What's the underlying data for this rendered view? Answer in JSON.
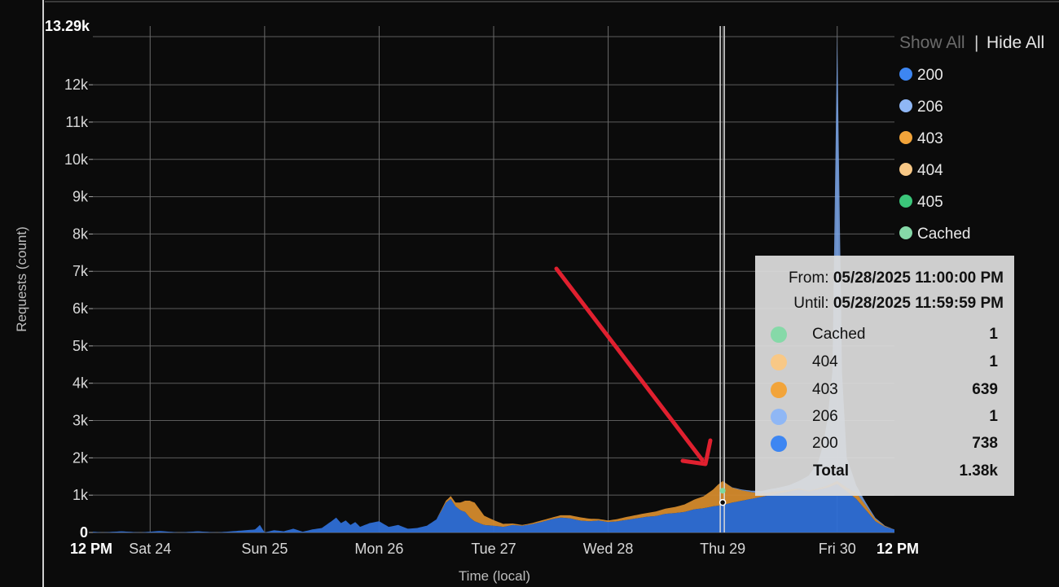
{
  "chart_data": {
    "type": "area",
    "stacked": true,
    "ylabel": "Requests (count)",
    "xlabel": "Time (local)",
    "y_max_label": "13.29k",
    "ylim": [
      0,
      13290
    ],
    "y_ticks": [
      {
        "value": 0,
        "label": "0"
      },
      {
        "value": 1000,
        "label": "1k"
      },
      {
        "value": 2000,
        "label": "2k"
      },
      {
        "value": 3000,
        "label": "3k"
      },
      {
        "value": 4000,
        "label": "4k"
      },
      {
        "value": 5000,
        "label": "5k"
      },
      {
        "value": 6000,
        "label": "6k"
      },
      {
        "value": 7000,
        "label": "7k"
      },
      {
        "value": 8000,
        "label": "8k"
      },
      {
        "value": 9000,
        "label": "9k"
      },
      {
        "value": 10000,
        "label": "10k"
      },
      {
        "value": 11000,
        "label": "11k"
      },
      {
        "value": 12000,
        "label": "12k"
      }
    ],
    "x_range_hours": [
      0,
      144
    ],
    "x_ticks": [
      {
        "hour": 0,
        "label": "12 PM",
        "bold": true,
        "grid": false
      },
      {
        "hour": 12,
        "label": "Sat 24",
        "bold": false,
        "grid": true
      },
      {
        "hour": 36,
        "label": "Sun 25",
        "bold": false,
        "grid": true
      },
      {
        "hour": 60,
        "label": "Mon 26",
        "bold": false,
        "grid": true
      },
      {
        "hour": 84,
        "label": "Tue 27",
        "bold": false,
        "grid": true
      },
      {
        "hour": 108,
        "label": "Wed 28",
        "bold": false,
        "grid": true
      },
      {
        "hour": 132,
        "label": "Thu 29",
        "bold": false,
        "grid": true
      },
      {
        "hour": 156,
        "label": "Fri 30",
        "bold": false,
        "grid": true
      },
      {
        "hour": 168,
        "label": "12 PM",
        "bold": true,
        "grid": false
      }
    ],
    "legend_position": "right",
    "series": [
      {
        "name": "200",
        "color": "#2f6fd6",
        "points": [
          [
            0,
            20
          ],
          [
            2,
            0
          ],
          [
            6,
            30
          ],
          [
            10,
            0
          ],
          [
            14,
            40
          ],
          [
            18,
            0
          ],
          [
            22,
            30
          ],
          [
            26,
            0
          ],
          [
            30,
            40
          ],
          [
            34,
            80
          ],
          [
            35,
            200
          ],
          [
            36,
            0
          ],
          [
            38,
            60
          ],
          [
            40,
            30
          ],
          [
            42,
            100
          ],
          [
            44,
            20
          ],
          [
            46,
            80
          ],
          [
            48,
            120
          ],
          [
            50,
            300
          ],
          [
            51,
            400
          ],
          [
            52,
            250
          ],
          [
            53,
            320
          ],
          [
            54,
            200
          ],
          [
            55,
            280
          ],
          [
            56,
            150
          ],
          [
            58,
            250
          ],
          [
            60,
            300
          ],
          [
            62,
            150
          ],
          [
            64,
            200
          ],
          [
            66,
            100
          ],
          [
            68,
            120
          ],
          [
            70,
            180
          ],
          [
            72,
            350
          ],
          [
            74,
            800
          ],
          [
            75,
            900
          ],
          [
            76,
            700
          ],
          [
            77,
            600
          ],
          [
            78,
            550
          ],
          [
            79,
            400
          ],
          [
            80,
            300
          ],
          [
            82,
            200
          ],
          [
            84,
            180
          ],
          [
            86,
            150
          ],
          [
            88,
            200
          ],
          [
            90,
            180
          ],
          [
            92,
            220
          ],
          [
            94,
            280
          ],
          [
            96,
            350
          ],
          [
            98,
            400
          ],
          [
            100,
            380
          ],
          [
            102,
            320
          ],
          [
            104,
            300
          ],
          [
            106,
            320
          ],
          [
            108,
            280
          ],
          [
            110,
            300
          ],
          [
            112,
            340
          ],
          [
            114,
            380
          ],
          [
            116,
            420
          ],
          [
            118,
            440
          ],
          [
            120,
            500
          ],
          [
            122,
            520
          ],
          [
            124,
            550
          ],
          [
            126,
            620
          ],
          [
            128,
            650
          ],
          [
            130,
            700
          ],
          [
            132,
            738
          ],
          [
            134,
            800
          ],
          [
            136,
            850
          ],
          [
            138,
            900
          ],
          [
            140,
            950
          ],
          [
            142,
            1000
          ],
          [
            144,
            1050
          ],
          [
            146,
            1100
          ],
          [
            148,
            1150
          ],
          [
            150,
            1100
          ],
          [
            152,
            1150
          ],
          [
            154,
            1200
          ],
          [
            156,
            1300
          ],
          [
            158,
            1100
          ],
          [
            160,
            900
          ],
          [
            162,
            600
          ],
          [
            164,
            300
          ],
          [
            166,
            150
          ],
          [
            168,
            80
          ]
        ]
      },
      {
        "name": "206",
        "color": "#6b9be8",
        "points": [
          [
            0,
            0
          ],
          [
            130,
            0
          ],
          [
            132,
            1
          ],
          [
            134,
            10
          ],
          [
            136,
            20
          ],
          [
            138,
            40
          ],
          [
            140,
            60
          ],
          [
            142,
            80
          ],
          [
            144,
            100
          ],
          [
            146,
            130
          ],
          [
            148,
            200
          ],
          [
            150,
            400
          ],
          [
            152,
            700
          ],
          [
            153,
            1100
          ],
          [
            154,
            1800
          ],
          [
            155,
            3000
          ],
          [
            156,
            12000
          ],
          [
            157,
            3000
          ],
          [
            158,
            800
          ],
          [
            160,
            200
          ],
          [
            162,
            80
          ],
          [
            164,
            30
          ],
          [
            166,
            10
          ],
          [
            168,
            0
          ]
        ]
      },
      {
        "name": "403",
        "color": "#d48a2c",
        "points": [
          [
            0,
            0
          ],
          [
            72,
            0
          ],
          [
            76,
            100
          ],
          [
            78,
            300
          ],
          [
            79,
            450
          ],
          [
            80,
            500
          ],
          [
            81,
            380
          ],
          [
            82,
            250
          ],
          [
            84,
            150
          ],
          [
            86,
            80
          ],
          [
            88,
            40
          ],
          [
            90,
            20
          ],
          [
            92,
            30
          ],
          [
            94,
            40
          ],
          [
            96,
            40
          ],
          [
            98,
            60
          ],
          [
            100,
            80
          ],
          [
            102,
            90
          ],
          [
            104,
            70
          ],
          [
            106,
            40
          ],
          [
            108,
            40
          ],
          [
            110,
            60
          ],
          [
            112,
            80
          ],
          [
            114,
            90
          ],
          [
            116,
            100
          ],
          [
            118,
            120
          ],
          [
            120,
            140
          ],
          [
            122,
            160
          ],
          [
            124,
            200
          ],
          [
            126,
            260
          ],
          [
            128,
            320
          ],
          [
            130,
            450
          ],
          [
            131,
            560
          ],
          [
            132,
            639
          ],
          [
            133,
            520
          ],
          [
            134,
            400
          ],
          [
            136,
            280
          ],
          [
            138,
            180
          ],
          [
            140,
            100
          ],
          [
            142,
            80
          ],
          [
            144,
            60
          ],
          [
            146,
            40
          ],
          [
            148,
            30
          ],
          [
            150,
            20
          ],
          [
            152,
            30
          ],
          [
            154,
            60
          ],
          [
            156,
            80
          ],
          [
            158,
            100
          ],
          [
            160,
            160
          ],
          [
            162,
            120
          ],
          [
            164,
            60
          ],
          [
            166,
            20
          ],
          [
            168,
            0
          ]
        ]
      },
      {
        "name": "404",
        "color": "#f5c37a",
        "points": [
          [
            0,
            0
          ],
          [
            131,
            0
          ],
          [
            132,
            1
          ],
          [
            133,
            0
          ],
          [
            168,
            0
          ]
        ]
      },
      {
        "name": "405",
        "color": "#3fbf71",
        "points": [
          [
            0,
            0
          ],
          [
            168,
            0
          ]
        ]
      },
      {
        "name": "Cached",
        "color": "#7ddba0",
        "points": [
          [
            0,
            0
          ],
          [
            131,
            0
          ],
          [
            132,
            1
          ],
          [
            133,
            0
          ],
          [
            168,
            0
          ]
        ]
      }
    ]
  },
  "legend": {
    "show_all": "Show All",
    "separator": "|",
    "hide_all": "Hide All",
    "items": [
      {
        "label": "200",
        "color": "#3d86f2"
      },
      {
        "label": "206",
        "color": "#8fb7f5"
      },
      {
        "label": "403",
        "color": "#f2a43a"
      },
      {
        "label": "404",
        "color": "#f8c886"
      },
      {
        "label": "405",
        "color": "#3bc67a"
      },
      {
        "label": "Cached",
        "color": "#86d9a8"
      }
    ]
  },
  "tooltip": {
    "from_label": "From:",
    "from_value": "05/28/2025 11:00:00 PM",
    "until_label": "Until:",
    "until_value": "05/28/2025 11:59:59 PM",
    "rows": [
      {
        "label": "Cached",
        "value": "1",
        "color": "#86d9a8"
      },
      {
        "label": "404",
        "value": "1",
        "color": "#f8c886"
      },
      {
        "label": "403",
        "value": "639",
        "color": "#f2a43a"
      },
      {
        "label": "206",
        "value": "1",
        "color": "#8fb7f5"
      },
      {
        "label": "200",
        "value": "738",
        "color": "#3d86f2"
      }
    ],
    "total_label": "Total",
    "total_value": "1.38k"
  },
  "hover_hour": 132,
  "annotation": {
    "type": "arrow",
    "color": "#e0202f"
  }
}
